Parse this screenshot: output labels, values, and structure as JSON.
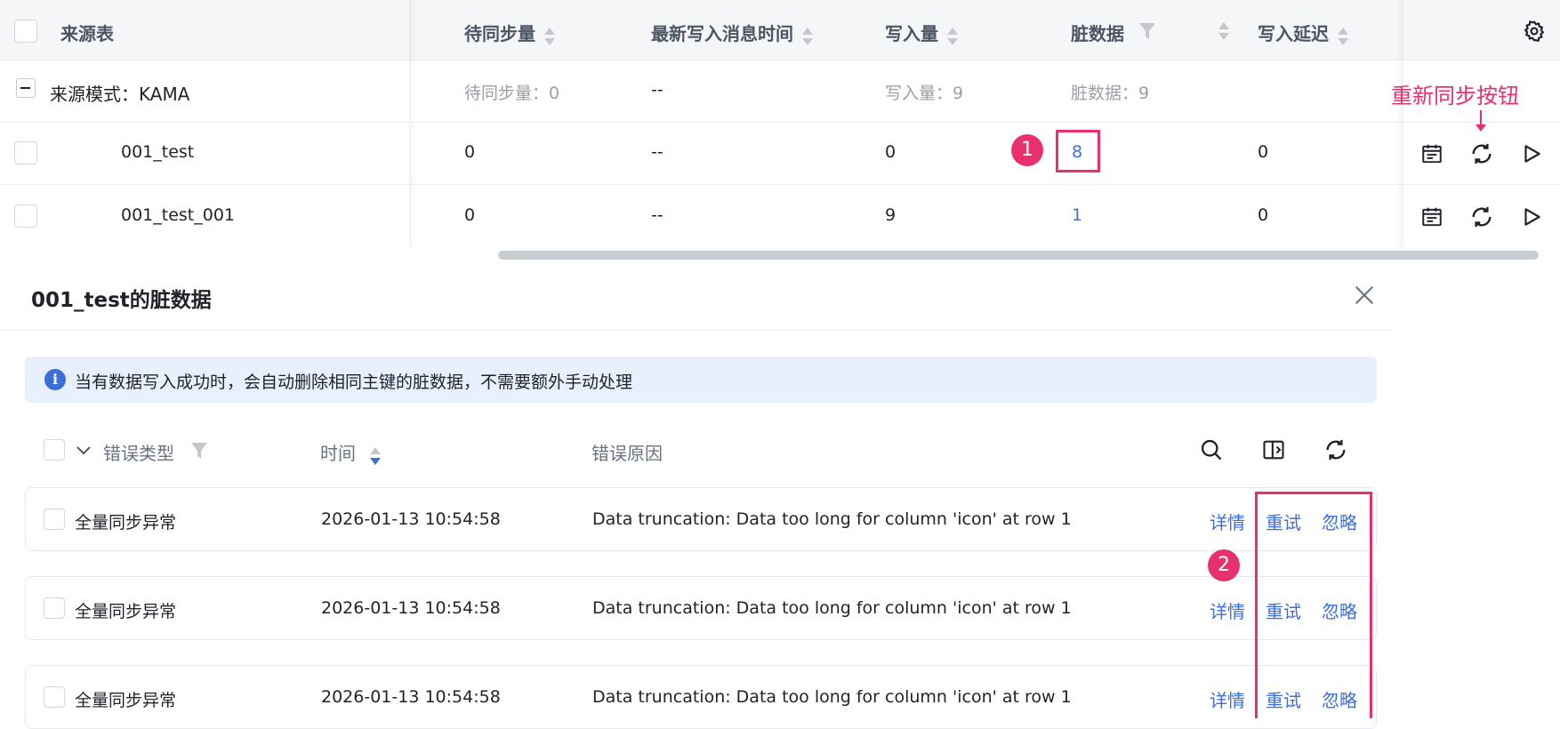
{
  "table": {
    "headers": {
      "source_table": "来源表",
      "pending": "待同步量",
      "latest_time": "最新写入消息时间",
      "write_count": "写入量",
      "dirty": "脏数据",
      "write_delay": "写入延迟"
    },
    "group": {
      "label": "来源模式：KAMA",
      "pending": "待同步量：0",
      "latest_time": "--",
      "write_count": "写入量：9",
      "dirty": "脏数据：9"
    },
    "rows": [
      {
        "name": "001_test",
        "pending": "0",
        "latest_time": "--",
        "write_count": "0",
        "dirty": "8",
        "delay": "0"
      },
      {
        "name": "001_test_001",
        "pending": "0",
        "latest_time": "--",
        "write_count": "9",
        "dirty": "1",
        "delay": "0"
      }
    ]
  },
  "annotations": {
    "resync_label": "重新同步按钮",
    "badge1": "1",
    "badge2": "2",
    "color": "#e9306f"
  },
  "panel": {
    "title": "001_test的脏数据",
    "info": "当有数据写入成功时，会自动删除相同主键的脏数据，不需要额外手动处理",
    "headers": {
      "error_type": "错误类型",
      "time": "时间",
      "reason": "错误原因"
    },
    "rows": [
      {
        "type": "全量同步异常",
        "time": "2026-01-13 10:54:58",
        "reason": "Data truncation: Data too long for column 'icon' at row 1",
        "detail": "详情",
        "retry": "重试",
        "ignore": "忽略"
      },
      {
        "type": "全量同步异常",
        "time": "2026-01-13 10:54:58",
        "reason": "Data truncation: Data too long for column 'icon' at row 1",
        "detail": "详情",
        "retry": "重试",
        "ignore": "忽略"
      },
      {
        "type": "全量同步异常",
        "time": "2026-01-13 10:54:58",
        "reason": "Data truncation: Data too long for column 'icon' at row 1",
        "detail": "详情",
        "retry": "重试",
        "ignore": "忽略"
      }
    ]
  },
  "colors": {
    "accent": "#3b6fd8",
    "info_bg": "#e8f0fd",
    "header_bg": "#f5f6f8"
  }
}
